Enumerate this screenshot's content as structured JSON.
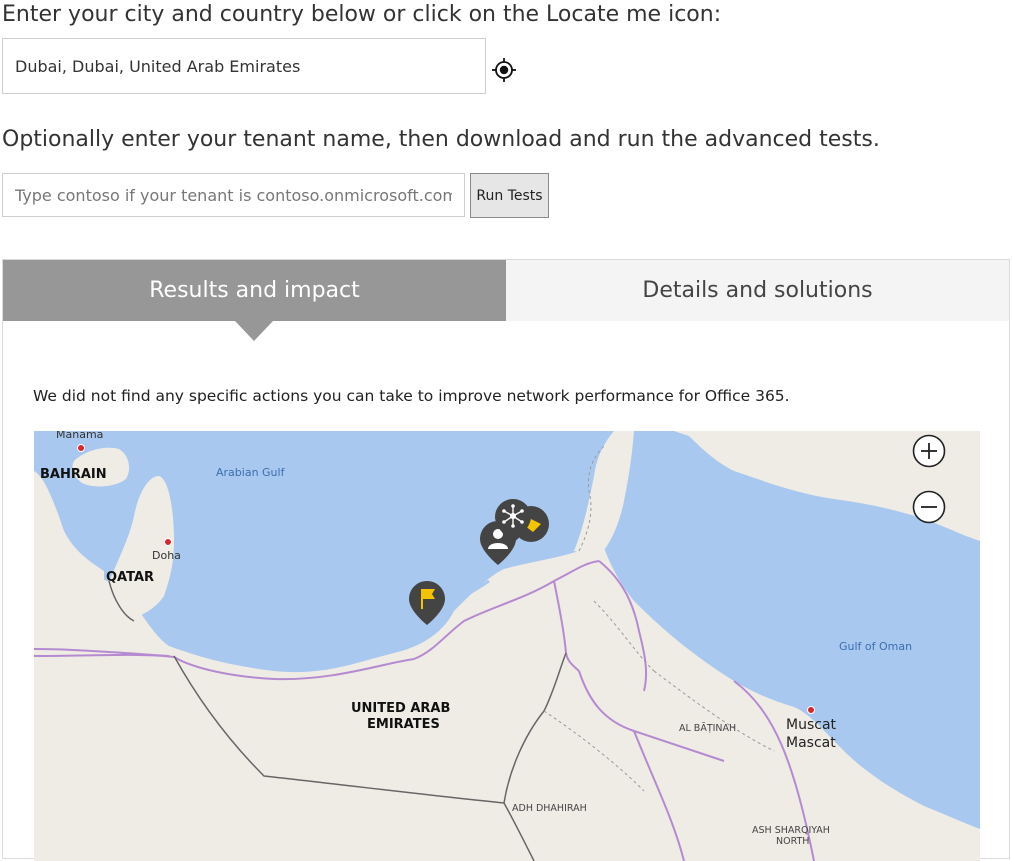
{
  "location": {
    "heading": "Enter your city and country below or click on the Locate me icon:",
    "value": "Dubai, Dubai, United Arab Emirates",
    "locate_icon": "crosshair-icon"
  },
  "tenant": {
    "heading": "Optionally enter your tenant name, then download and run the advanced tests.",
    "placeholder": "Type contoso if your tenant is contoso.onmicrosoft.com",
    "value": "",
    "run_label": "Run Tests"
  },
  "tabs": [
    {
      "label": "Results and impact",
      "active": true
    },
    {
      "label": "Details and solutions",
      "active": false
    }
  ],
  "results": {
    "summary": "We did not find any specific actions you can take to improve network performance for Office 365."
  },
  "map": {
    "labels": {
      "manama": "Manama",
      "bahrain": "BAHRAIN",
      "arabian_gulf": "Arabian Gulf",
      "doha": "Doha",
      "qatar": "QATAR",
      "uae_line1": "UNITED ARAB",
      "uae_line2": "EMIRATES",
      "gulf_of_oman": "Gulf of Oman",
      "al_batinah": "AL BĀṬINAH",
      "muscat_1": "Muscat",
      "muscat_2": "Mascat",
      "adh_dhahirah": "ADH DHAHIRAH",
      "ash_sharqiyah_1": "ASH SHARQIYAH",
      "ash_sharqiyah_2": "NORTH"
    },
    "pins": [
      "flag-pin-icon",
      "user-pin-icon",
      "network-pin-icon",
      "tag-pin-icon"
    ],
    "zoom_in_icon": "plus-icon",
    "zoom_out_icon": "minus-icon",
    "colors": {
      "water": "#a9c8ef",
      "land": "#efece6",
      "border": "#b58ad1",
      "pin": "#444444",
      "accent": "#f5c400"
    }
  }
}
